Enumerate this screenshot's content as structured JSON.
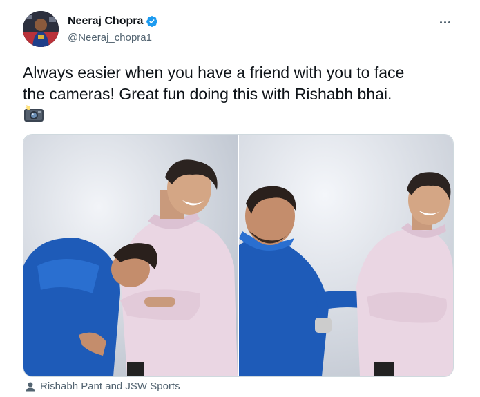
{
  "tweet": {
    "author": {
      "display_name": "Neeraj Chopra",
      "handle": "@Neeraj_chopra1",
      "verified": true
    },
    "text": "Always easier when you have a friend with you to face\nthe cameras! Great fun doing this with Rishabh bhai.",
    "text_emoji": "camera-with-flash",
    "media": [
      {
        "name": "photo-1"
      },
      {
        "name": "photo-2"
      }
    ],
    "tagged_people": "Rishabh Pant and JSW Sports"
  },
  "colors": {
    "verified_blue": "#1d9bf0",
    "secondary_text": "#536471",
    "primary_text": "#0f1419"
  },
  "icons": [
    "verified-badge-icon",
    "more-options-icon",
    "camera-flash-icon",
    "person-icon"
  ]
}
